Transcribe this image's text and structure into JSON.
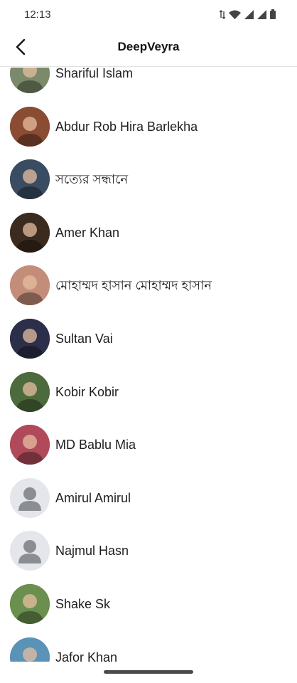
{
  "status_bar": {
    "time": "12:13",
    "icons": [
      "data-arrows-icon",
      "wifi-icon",
      "signal-icon",
      "signal-icon",
      "battery-icon"
    ]
  },
  "header": {
    "back_icon": "chevron-left-icon",
    "title": "DeepVeyra"
  },
  "friends": [
    {
      "name": "Shariful Islam",
      "avatar": "photo",
      "color": "#7a8a6a"
    },
    {
      "name": "Abdur Rob Hira Barlekha",
      "avatar": "photo",
      "color": "#8a4c32"
    },
    {
      "name": "সত্যের সন্ধানে",
      "avatar": "photo",
      "color": "#3a4c62"
    },
    {
      "name": "Amer Khan",
      "avatar": "photo",
      "color": "#3b2a1e"
    },
    {
      "name": "মোহাম্মদ হাসান মোহাম্মদ হাসান",
      "avatar": "photo",
      "color": "#c48d7a"
    },
    {
      "name": "Sultan Vai",
      "avatar": "photo",
      "color": "#2b2f4a"
    },
    {
      "name": "Kobir Kobir",
      "avatar": "photo",
      "color": "#4d6a3c"
    },
    {
      "name": "MD Bablu Mia",
      "avatar": "photo",
      "color": "#b04a5a"
    },
    {
      "name": "Amirul Amirul",
      "avatar": "default",
      "color": "#e4e6eb"
    },
    {
      "name": "Najmul Hasn",
      "avatar": "default",
      "color": "#e4e6eb"
    },
    {
      "name": "Shake Sk",
      "avatar": "photo",
      "color": "#6b8f4e"
    },
    {
      "name": "Jafor Khan",
      "avatar": "photo",
      "color": "#5a92b8"
    }
  ]
}
